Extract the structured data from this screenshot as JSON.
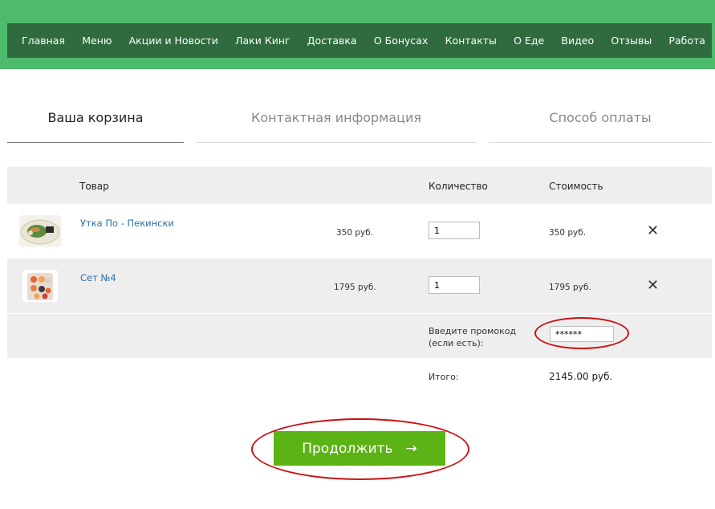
{
  "nav": {
    "items": [
      "Главная",
      "Меню",
      "Акции и Новости",
      "Лаки Кинг",
      "Доставка",
      "О Бонусах",
      "Контакты",
      "О Еде",
      "Видео",
      "Отзывы",
      "Работа"
    ]
  },
  "steps": [
    {
      "label": "Ваша корзина",
      "active": true
    },
    {
      "label": "Контактная информация",
      "active": false
    },
    {
      "label": "Способ оплаты",
      "active": false
    }
  ],
  "cart": {
    "headers": {
      "product": "Товар",
      "quantity": "Количество",
      "cost": "Стоимость"
    },
    "items": [
      {
        "name": "Утка По - Пекински",
        "price": "350 руб.",
        "quantity": "1",
        "cost": "350 руб.",
        "remove_icon": "close-icon"
      },
      {
        "name": "Сет №4",
        "price": "1795 руб.",
        "quantity": "1",
        "cost": "1795 руб.",
        "remove_icon": "close-icon"
      }
    ],
    "promo": {
      "label_line1": "Введите промокод",
      "label_line2": "(если есть):",
      "value": "******"
    },
    "total": {
      "label": "Итого:",
      "value": "2145.00 руб."
    }
  },
  "continue_button": {
    "label": "Продолжить",
    "arrow": "→"
  },
  "colors": {
    "header_bg": "#4dbb6b",
    "nav_bg": "#2f6b3e",
    "button_bg": "#5cb315",
    "link": "#2a6fb0",
    "highlight": "#cc1111"
  }
}
